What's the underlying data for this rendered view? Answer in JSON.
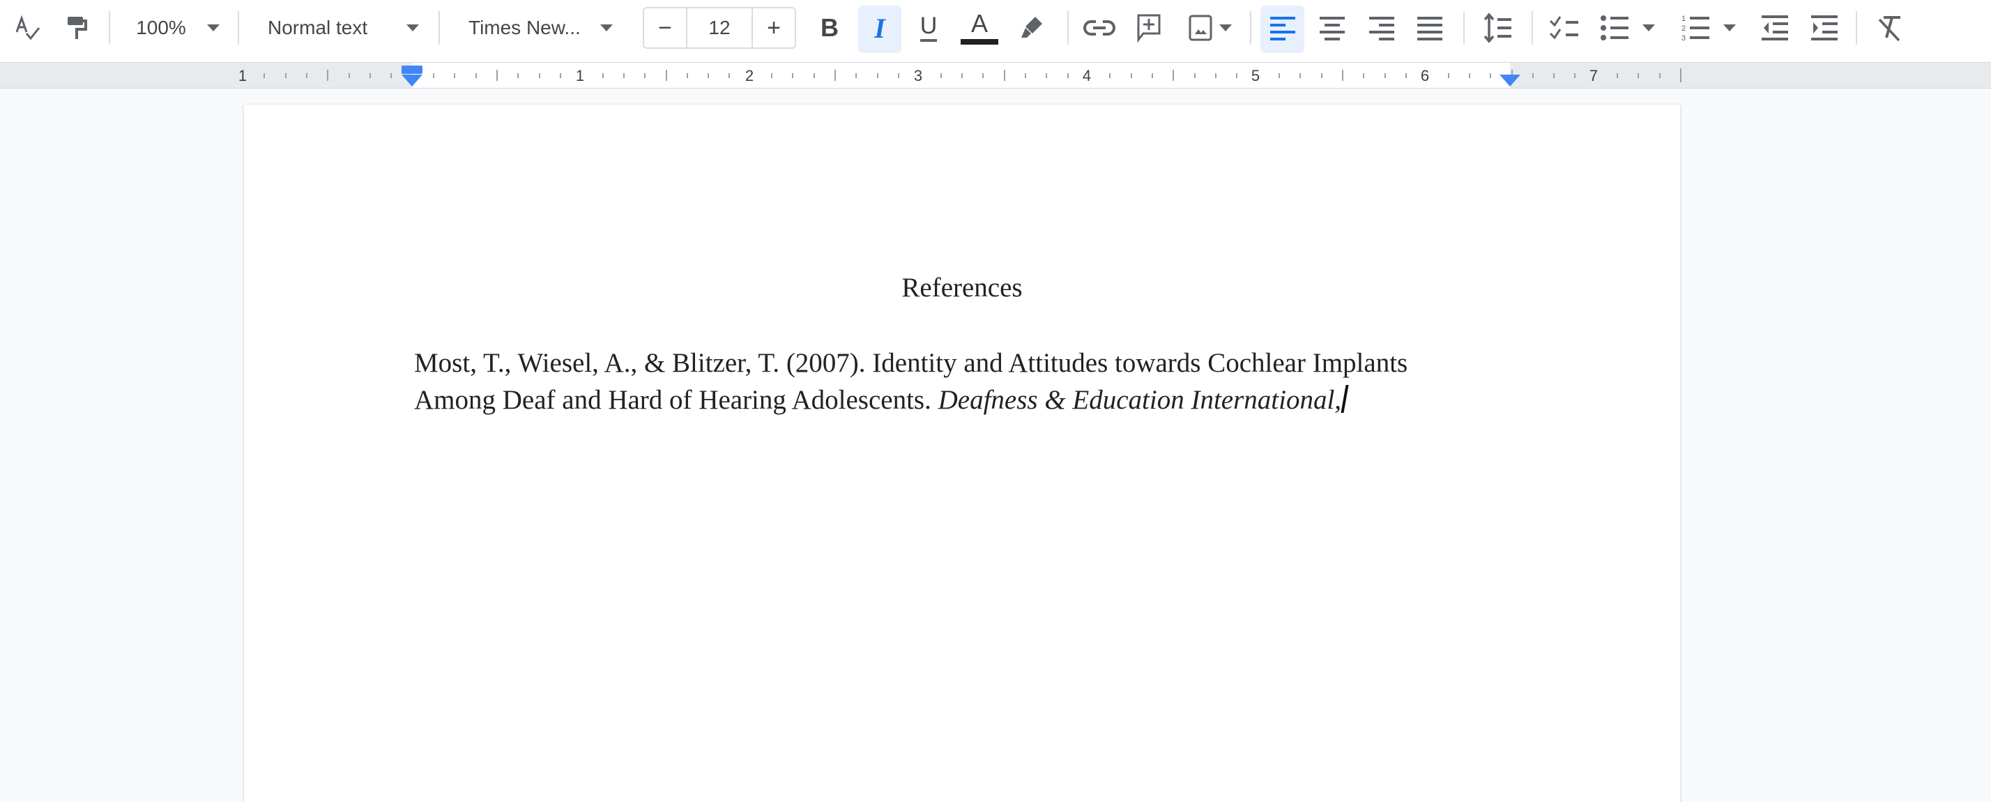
{
  "toolbar": {
    "spellcheck_icon": "spellcheck-icon",
    "paint_format_icon": "paint-format-icon",
    "zoom": {
      "value": "100%"
    },
    "style": {
      "value": "Normal text"
    },
    "font": {
      "value": "Times New..."
    },
    "font_size": {
      "decrease": "−",
      "value": "12",
      "increase": "+"
    },
    "bold": {
      "label": "B",
      "active": false
    },
    "italic": {
      "label": "I",
      "active": true
    },
    "underline": {
      "label": "U",
      "active": false
    },
    "text_color": {
      "label": "A",
      "color": "#202124"
    },
    "highlight_color_icon": "highlighter-icon",
    "insert_link_icon": "link-icon",
    "add_comment_icon": "add-comment-icon",
    "insert_image_icon": "image-icon",
    "align": {
      "active": "left",
      "options": [
        "left",
        "center",
        "right",
        "justify"
      ]
    },
    "line_spacing_icon": "line-spacing-icon",
    "checklist_icon": "checklist-icon",
    "bulleted_list_icon": "bulleted-list-icon",
    "numbered_list_icon": "numbered-list-icon",
    "decrease_indent_icon": "decrease-indent-icon",
    "increase_indent_icon": "increase-indent-icon",
    "clear_formatting_icon": "clear-formatting-icon",
    "accent_color": "#1a73e8"
  },
  "ruler": {
    "labels": [
      "1",
      "1",
      "2",
      "3",
      "4",
      "5",
      "6",
      "7"
    ],
    "units": "inches"
  },
  "document": {
    "heading": "References",
    "reference": {
      "line1": "Most, T., Wiesel, A., & Blitzer, T. (2007). Identity and Attitudes towards Cochlear Implants",
      "line2_plain": "Among Deaf and Hard of Hearing Adolescents. ",
      "line2_italic": "Deafness & Education International,"
    }
  }
}
